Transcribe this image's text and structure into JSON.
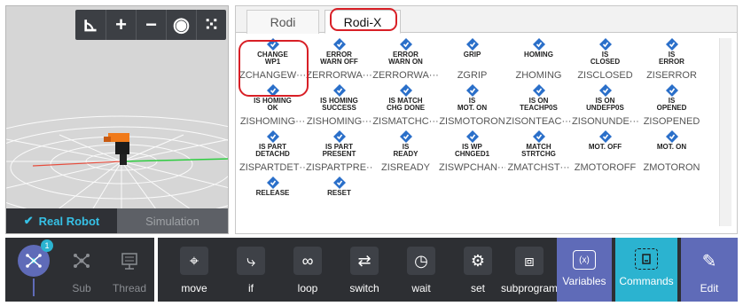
{
  "viewport": {
    "toolbar": [
      {
        "icon": "axis-icon",
        "glyph": "⊾"
      },
      {
        "icon": "zoom-in-icon",
        "glyph": "+"
      },
      {
        "icon": "zoom-out-icon",
        "glyph": "−"
      },
      {
        "icon": "eye-icon",
        "glyph": "◉"
      },
      {
        "icon": "grid-icon",
        "glyph": "⁙"
      }
    ],
    "modes": {
      "real": "Real Robot",
      "sim": "Simulation",
      "check": "✔"
    }
  },
  "tabs": {
    "rodi": "Rodi",
    "rodix": "Rodi-X"
  },
  "commands": [
    {
      "title": "CHANGE\nWP1",
      "sub": "ZCHANGEW···"
    },
    {
      "title": "ERROR\nWARN OFF",
      "sub": "ZERRORWA···"
    },
    {
      "title": "ERROR\nWARN ON",
      "sub": "ZERRORWA···"
    },
    {
      "title": "GRIP",
      "sub": "ZGRIP"
    },
    {
      "title": "HOMING",
      "sub": "ZHOMING"
    },
    {
      "title": "IS\nCLOSED",
      "sub": "ZISCLOSED"
    },
    {
      "title": "IS\nERROR",
      "sub": "ZISERROR"
    },
    {
      "title": "IS HOMING\nOK",
      "sub": "ZISHOMING···"
    },
    {
      "title": "IS HOMING\nSUCCESS",
      "sub": "ZISHOMING···"
    },
    {
      "title": "IS MATCH\nCHG DONE",
      "sub": "ZISMATCHC···"
    },
    {
      "title": "IS\nMOT. ON",
      "sub": "ZISMOTORON"
    },
    {
      "title": "IS ON\nTEACHP0S",
      "sub": "ZISONTEAC···"
    },
    {
      "title": "IS ON\nUNDEFP0S",
      "sub": "ZISONUNDE···"
    },
    {
      "title": "IS\nOPENED",
      "sub": "ZISOPENED"
    },
    {
      "title": "IS PART\nDETACHD",
      "sub": "ZISPARTDET···"
    },
    {
      "title": "IS PART\nPRESENT",
      "sub": "ZISPARTPRE···"
    },
    {
      "title": "IS\nREADY",
      "sub": "ZISREADY"
    },
    {
      "title": "IS WP\nCHNGED1",
      "sub": "ZISWPCHAN···"
    },
    {
      "title": "MATCH\nSTRTCHG",
      "sub": "ZMATCHST···"
    },
    {
      "title": "MOT. OFF",
      "sub": "ZMOTOROFF"
    },
    {
      "title": "MOT. ON",
      "sub": "ZMOTORON"
    },
    {
      "title": "RELEASE",
      "sub": ""
    },
    {
      "title": "RESET",
      "sub": ""
    }
  ],
  "bottom": {
    "badge": "1",
    "left_items": [
      {
        "label": "",
        "icon": "node-icon"
      },
      {
        "label": "Sub",
        "icon": "sub-icon"
      },
      {
        "label": "Thread",
        "icon": "thread-icon"
      }
    ],
    "items": [
      {
        "label": "move",
        "icon": "move-icon"
      },
      {
        "label": "if",
        "icon": "if-icon"
      },
      {
        "label": "loop",
        "icon": "loop-icon"
      },
      {
        "label": "switch",
        "icon": "switch-icon"
      },
      {
        "label": "wait",
        "icon": "wait-icon"
      },
      {
        "label": "set",
        "icon": "set-icon"
      },
      {
        "label": "subprogram",
        "icon": "subprogram-icon"
      }
    ],
    "right_items": [
      {
        "label": "Variables",
        "icon": "variables-icon"
      },
      {
        "label": "Commands",
        "icon": "commands-icon"
      },
      {
        "label": "Edit",
        "icon": "edit-icon"
      }
    ]
  },
  "colors": {
    "accent": "#2bb3d0",
    "highlight": "#d81f26",
    "purple": "#5f6bb8",
    "dark": "#2d2f33"
  }
}
